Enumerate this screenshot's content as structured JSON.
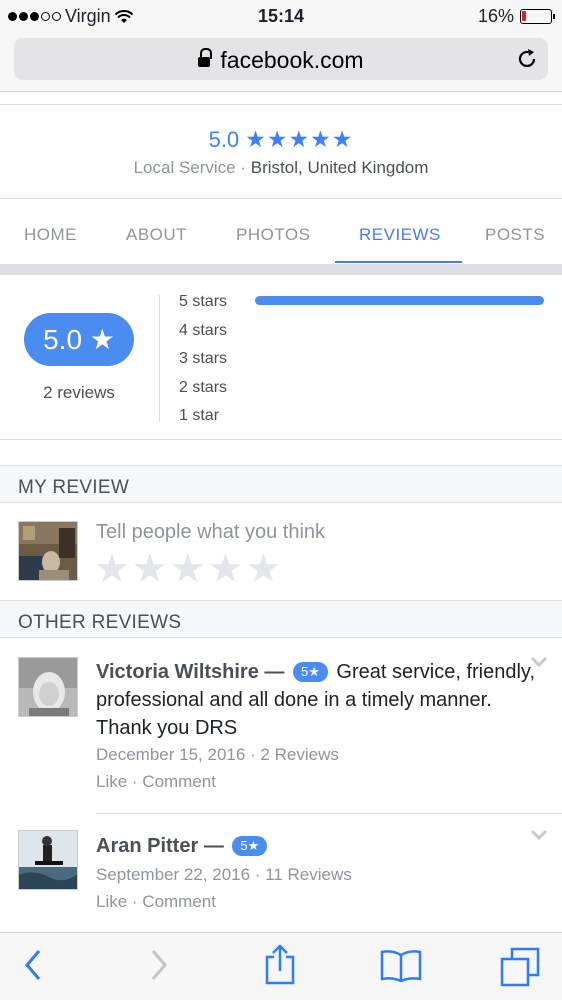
{
  "status_bar": {
    "carrier": "Virgin",
    "time": "15:14",
    "battery_percent": "16%",
    "battery_level": 0.16
  },
  "browser": {
    "url": "facebook.com"
  },
  "page_header": {
    "rating": "5.0",
    "stars": "★★★★★",
    "category": "Local Service",
    "separator": "·",
    "location": "Bristol, United Kingdom"
  },
  "tabs": [
    {
      "label": "HOME",
      "active": false
    },
    {
      "label": "ABOUT",
      "active": false
    },
    {
      "label": "PHOTOS",
      "active": false
    },
    {
      "label": "REVIEWS",
      "active": true
    },
    {
      "label": "POSTS",
      "active": false
    }
  ],
  "summary": {
    "score": "5.0 ★",
    "review_count": "2 reviews",
    "distribution": [
      {
        "label": "5 stars",
        "fraction": 1.0
      },
      {
        "label": "4 stars",
        "fraction": 0
      },
      {
        "label": "3 stars",
        "fraction": 0
      },
      {
        "label": "2 stars",
        "fraction": 0
      },
      {
        "label": "1 star",
        "fraction": 0
      }
    ]
  },
  "my_review": {
    "heading": "MY REVIEW",
    "prompt": "Tell people what you think",
    "empty_stars": "★★★★★"
  },
  "other_reviews": {
    "heading": "OTHER REVIEWS",
    "items": [
      {
        "name": "Victoria Wiltshire",
        "dash": "—",
        "rating": "5★",
        "text": "Great service, friendly, professional and all done in a timely manner. Thank you DRS",
        "date": "December 15, 2016 · 2 Reviews",
        "actions": "Like · Comment"
      },
      {
        "name": "Aran Pitter",
        "dash": "—",
        "rating": "5★",
        "text": "",
        "date": "September 22, 2016 · 11 Reviews",
        "actions": "Like · Comment"
      }
    ]
  },
  "colors": {
    "accent": "#4b8cf0",
    "link": "#4b7bec",
    "muted": "#90949c"
  }
}
